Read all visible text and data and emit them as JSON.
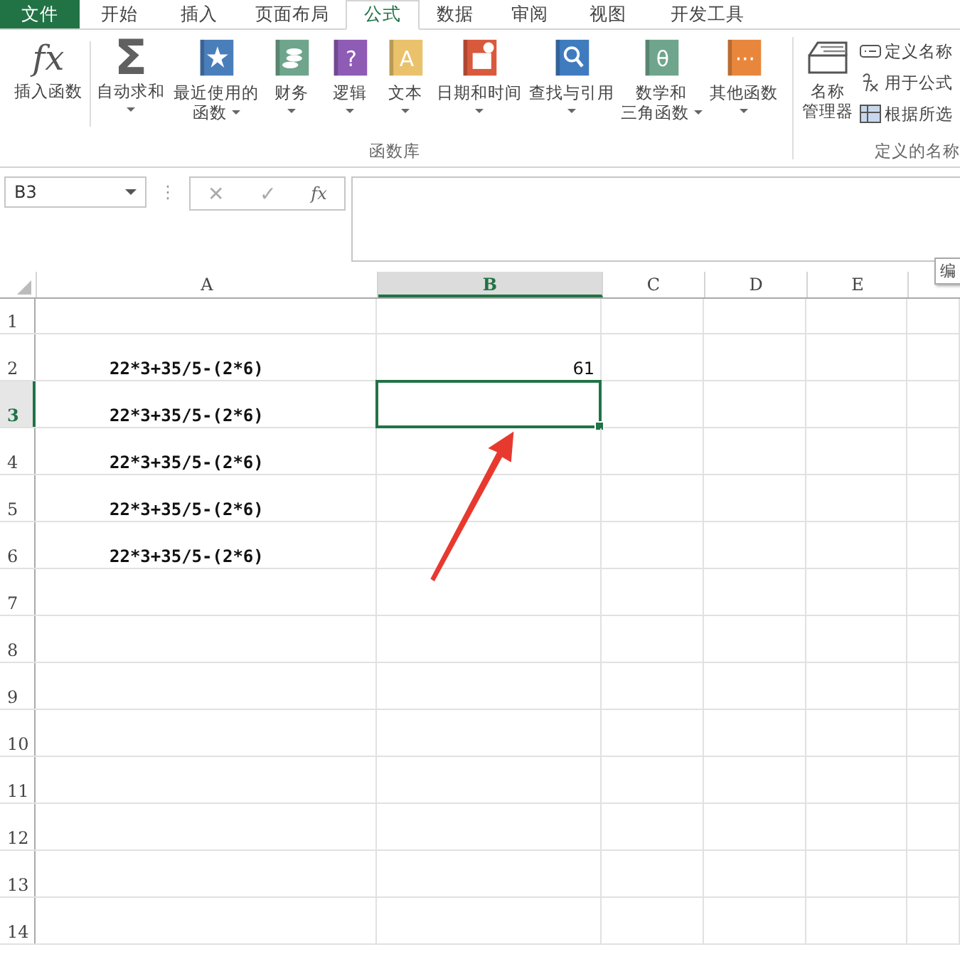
{
  "tabs": [
    {
      "label": "文件",
      "kind": "file",
      "selected": false
    },
    {
      "label": "开始",
      "kind": "tab",
      "selected": false
    },
    {
      "label": "插入",
      "kind": "tab",
      "selected": false
    },
    {
      "label": "页面布局",
      "kind": "tab",
      "selected": false
    },
    {
      "label": "公式",
      "kind": "tab",
      "selected": true
    },
    {
      "label": "数据",
      "kind": "tab",
      "selected": false
    },
    {
      "label": "审阅",
      "kind": "tab",
      "selected": false
    },
    {
      "label": "视图",
      "kind": "tab",
      "selected": false
    },
    {
      "label": "开发工具",
      "kind": "tab",
      "selected": false
    }
  ],
  "function_library": {
    "label": "函数库",
    "buttons": [
      {
        "lines": [
          "插入函数"
        ],
        "menu": false,
        "icon": {
          "kind": "glyph",
          "glyph": "fx"
        }
      },
      {
        "lines": [
          "自动求和"
        ],
        "menu": true,
        "icon": {
          "kind": "glyph",
          "glyph": "Σ"
        }
      },
      {
        "lines": [
          "最近使用的",
          "函数"
        ],
        "menu": true,
        "icon": {
          "kind": "star-book",
          "color": "#4a7ebb"
        }
      },
      {
        "lines": [
          "财务"
        ],
        "menu": true,
        "icon": {
          "kind": "coins-book",
          "color": "#6fa58c"
        }
      },
      {
        "lines": [
          "逻辑"
        ],
        "menu": true,
        "icon": {
          "kind": "glyph-book",
          "color": "#8e5bb5",
          "glyph": "?"
        }
      },
      {
        "lines": [
          "文本"
        ],
        "menu": true,
        "icon": {
          "kind": "glyph-book",
          "color": "#e9c26b",
          "glyph": "A"
        }
      },
      {
        "lines": [
          "日期和时间"
        ],
        "menu": true,
        "icon": {
          "kind": "calendar-book",
          "color": "#d9593c"
        }
      },
      {
        "lines": [
          "查找与引用"
        ],
        "menu": true,
        "icon": {
          "kind": "search-book",
          "color": "#3f7bbf"
        }
      },
      {
        "lines": [
          "数学和",
          "三角函数"
        ],
        "menu": true,
        "icon": {
          "kind": "glyph-book",
          "color": "#6fa58c",
          "glyph": "θ"
        }
      },
      {
        "lines": [
          "其他函数"
        ],
        "menu": true,
        "icon": {
          "kind": "glyph-book",
          "color": "#e8873c",
          "glyph": "···"
        }
      }
    ]
  },
  "defined_names": {
    "label": "定义的名称",
    "manager": [
      "名称",
      "管理器"
    ],
    "items": [
      {
        "label": "定义名称",
        "kind": "tag"
      },
      {
        "label": "用于公式",
        "kind": "formula"
      },
      {
        "label": "根据所选",
        "kind": "grid"
      }
    ]
  },
  "formula_bar": {
    "name_box": "B3",
    "more": "⋮",
    "cancel": "✕",
    "enter": "✓",
    "function": "fx"
  },
  "tooltip": "编",
  "columns": [
    {
      "label": "A",
      "selected": false
    },
    {
      "label": "B",
      "selected": true
    },
    {
      "label": "C",
      "selected": false
    },
    {
      "label": "D",
      "selected": false
    },
    {
      "label": "E",
      "selected": false
    }
  ],
  "rows": [
    {
      "label": "1",
      "selected": false
    },
    {
      "label": "2",
      "selected": false,
      "a": "22*3+35/5-(2*6)",
      "b": "61"
    },
    {
      "label": "3",
      "selected": true,
      "a": "22*3+35/5-(2*6)"
    },
    {
      "label": "4",
      "selected": false,
      "a": "22*3+35/5-(2*6)"
    },
    {
      "label": "5",
      "selected": false,
      "a": "22*3+35/5-(2*6)"
    },
    {
      "label": "6",
      "selected": false,
      "a": "22*3+35/5-(2*6)"
    },
    {
      "label": "7",
      "selected": false
    },
    {
      "label": "8",
      "selected": false
    },
    {
      "label": "9",
      "selected": false
    },
    {
      "label": "10",
      "selected": false
    },
    {
      "label": "11",
      "selected": false
    },
    {
      "label": "12",
      "selected": false
    },
    {
      "label": "13",
      "selected": false
    },
    {
      "label": "14",
      "selected": false
    }
  ]
}
